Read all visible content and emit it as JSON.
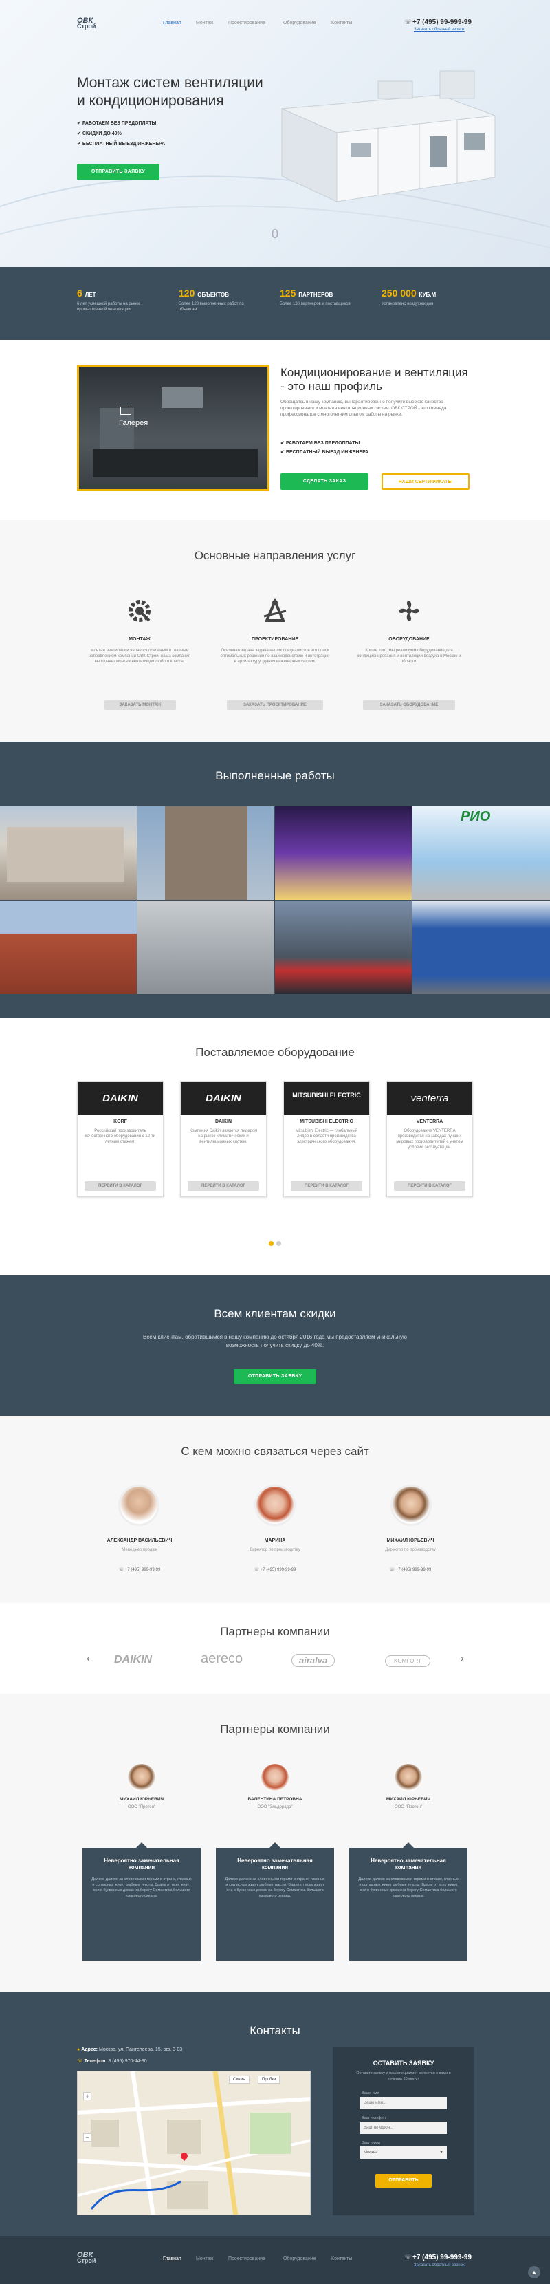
{
  "header": {
    "logo_top": "ОВК",
    "logo_bottom": "Строй",
    "nav": [
      "Главная",
      "Монтаж",
      "Проектирование",
      "Оборудование",
      "Контакты"
    ],
    "phone": "+7 (495) 99-999-99",
    "callback": "Заказать обратный звонок"
  },
  "hero": {
    "title_line1": "Монтаж систем вентиляции",
    "title_line2": "и кондиционирования",
    "bullets": [
      "РАБОТАЕМ БЕЗ ПРЕДОПЛАТЫ",
      "СКИДКИ ДО 40%",
      "БЕСПЛАТНЫЙ ВЫЕЗД ИНЖЕНЕРА"
    ],
    "button": "ОТПРАВИТЬ ЗАЯВКУ",
    "scroll_label": "0"
  },
  "stats": [
    {
      "num": "6",
      "unit": "ЛЕТ",
      "desc": "6 лет успешной работы на рынке промышленной вентиляции"
    },
    {
      "num": "120",
      "unit": "ОБЪЕКТОВ",
      "desc": "Более 120 выполненных работ по объектам"
    },
    {
      "num": "125",
      "unit": "ПАРТНЕРОВ",
      "desc": "Более 130 партнеров и поставщиков"
    },
    {
      "num": "250 000",
      "unit": "КУБ.М",
      "desc": "Установлено воздуховодов"
    }
  ],
  "profile": {
    "gallery_label": "Галерея",
    "title": "Кондиционирование и вентиляция - это наш профиль",
    "text": "Обращаясь в нашу компанию, вы гарантированно получите высокое качество проектирования и монтажа вентиляционных систем. ОВК СТРОЙ - это команда профессионалов с многолетним опытом работы на рынке.",
    "bullets": [
      "РАБОТАЕМ БЕЗ ПРЕДОПЛАТЫ",
      "БЕСПЛАТНЫЙ ВЫЕЗД ИНЖЕНЕРА"
    ],
    "btn1": "СДЕЛАТЬ ЗАКАЗ",
    "btn2": "НАШИ СЕРТИФИКАТЫ"
  },
  "services": {
    "title": "Основные направления услуг",
    "items": [
      {
        "icon": "gear-icon",
        "name": "МОНТАЖ",
        "text": "Монтаж вентиляции является основным и главным направлением компании ОВК Строй, наша компания выполняет монтаж вентиляции любого класса.",
        "btn": "ЗАКАЗАТЬ МОНТАЖ"
      },
      {
        "icon": "drafting-icon",
        "name": "ПРОЕКТИРОВАНИЕ",
        "text": "Основная задача задача наших специалистов это поиск оптимальных решений по взаимодействию и интеграции в архитектуру здания инженерных систем.",
        "btn": "ЗАКАЗАТЬ ПРОЕКТИРОВАНИЕ"
      },
      {
        "icon": "fan-icon",
        "name": "ОБОРУДОВАНИЕ",
        "text": "Кроме того, мы реализуем оборудование для кондиционирования и вентиляции воздуха в Москве и области.",
        "btn": "ЗАКАЗАТЬ ОБОРУДОВАНИЕ"
      }
    ]
  },
  "works": {
    "title": "Выполненные работы"
  },
  "equipment": {
    "title": "Поставляемое оборудование",
    "items": [
      {
        "brand": "DAIKIN",
        "name": "KORF",
        "text": "Российский производитель качественного оборудования с 12-ти летним стажем.",
        "btn": "ПЕРЕЙТИ В КАТАЛОГ"
      },
      {
        "brand": "DAIKIN",
        "name": "DAIKIN",
        "text": "Компания Daikin является лидером на рынке климатических и вентиляционных систем.",
        "btn": "ПЕРЕЙТИ В КАТАЛОГ"
      },
      {
        "brand": "MITSUBISHI ELECTRIC",
        "name": "MITSUBISHI ELECTRIC",
        "text": "Mitsubishi Electric — глобальный лидер в области производства электрического оборудования.",
        "btn": "ПЕРЕЙТИ В КАТАЛОГ"
      },
      {
        "brand": "venterra",
        "name": "VENTERRA",
        "text": "Оборудование VENTERRA производится на заводах лучших мировых производителей с учетом условий эксплуатации.",
        "btn": "ПЕРЕЙТИ В КАТАЛОГ"
      }
    ]
  },
  "discount": {
    "title": "Всем клиентам скидки",
    "text1": "Всем клиентам, обратившимся в нашу компанию до октября 2016 года мы предоставляем уникальную",
    "text2": "возможность получить скидку до 40%.",
    "btn": "ОТПРАВИТЬ ЗАЯВКУ"
  },
  "team": {
    "title": "С кем можно связаться через сайт",
    "people": [
      {
        "name": "АЛЕКСАНДР ВАСИЛЬЕВИЧ",
        "role": "Менеджер продаж",
        "phone": "+7 (495) 999-99-99"
      },
      {
        "name": "МАРИНА",
        "role": "Директор по производству",
        "phone": "+7 (495) 999-99-99"
      },
      {
        "name": "МИХАИЛ ЮРЬЕВИЧ",
        "role": "Директор по производству",
        "phone": "+7 (495) 999-99-99"
      }
    ]
  },
  "partners_logos": {
    "title": "Партнеры компании",
    "logos": [
      "DAIKIN",
      "aereco",
      "airalva",
      "KOMFORT"
    ]
  },
  "partners_reviews": {
    "title": "Партнеры компании",
    "items": [
      {
        "name": "МИХАИЛ ЮРЬЕВИЧ",
        "company": "ООО \"Протон\"",
        "heading": "Невероятно замечательная компания",
        "text": "Далеко-далеко за словесными горами в стране, гласных и согласных живут рыбные тексты. Вдали от всех живут они в буквенных домах на берегу Семантика большого языкового океана."
      },
      {
        "name": "ВАЛЕНТИНА ПЕТРОВНА",
        "company": "ООО \"Эльдорадо\"",
        "heading": "Невероятно замечательная компания",
        "text": "Далеко-далеко за словесными горами в стране, гласных и согласных живут рыбные тексты. Вдали от всех живут они в буквенных домах на берегу Семантика большого языкового океана."
      },
      {
        "name": "МИХАИЛ ЮРЬЕВИЧ",
        "company": "ООО \"Протон\"",
        "heading": "Невероятно замечательная компания",
        "text": "Далеко-далеко за словесными горами в стране, гласных и согласных живут рыбные тексты. Вдали от всех живут они в буквенных домах на берегу Семантика большого языкового океана."
      }
    ]
  },
  "contacts": {
    "title": "Контакты",
    "address_label": "Адрес:",
    "address": "Москва, ул. Пантелеева, 15, оф. 3-03",
    "phone_label": "Телефон:",
    "phone": "8 (495) 970-44-90",
    "form_title": "ОСТАВИТЬ ЗАЯВКУ",
    "form_sub": "Оставьте заявку и наш специалист свяжется с вами в течении 20 минут",
    "name_label": "Ваше имя",
    "name_ph": "Ваше имя...",
    "phone_field_label": "Ваш телефон",
    "phone_ph": "Ваш телефон...",
    "city_label": "Ваш город",
    "city_value": "Москва",
    "submit": "ОТПРАВИТЬ",
    "map_tab1": "Схема",
    "map_tab2": "Пробки"
  },
  "footer": {
    "logo_top": "ОВК",
    "logo_bottom": "Строй",
    "nav": [
      "Главная",
      "Монтаж",
      "Проектирование",
      "Оборудование",
      "Контакты"
    ],
    "phone": "+7 (495) 99-999-99",
    "callback": "Заказать обратный звонок"
  }
}
